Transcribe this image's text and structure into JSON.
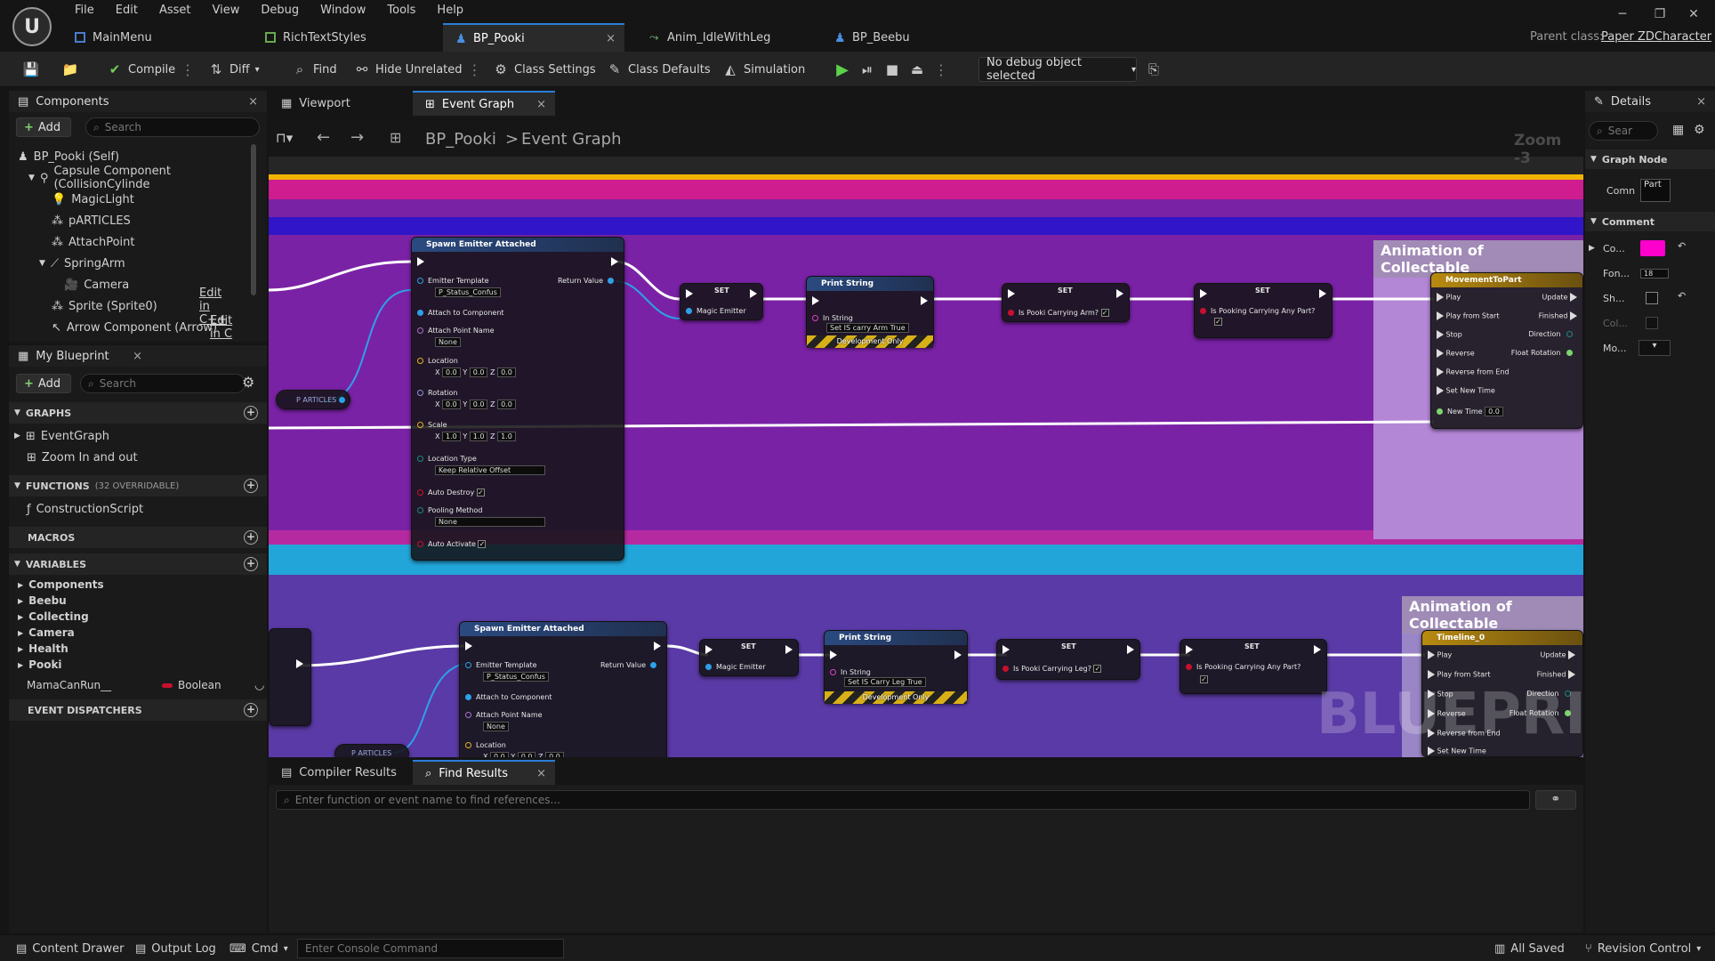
{
  "app": {
    "menu": [
      "File",
      "Edit",
      "Asset",
      "View",
      "Debug",
      "Window",
      "Tools",
      "Help"
    ],
    "tabs": [
      {
        "label": "MainMenu"
      },
      {
        "label": "RichTextStyles"
      },
      {
        "label": "BP_Pooki",
        "close": "×"
      },
      {
        "label": "Anim_IdleWithLeg"
      },
      {
        "label": "BP_Beebu"
      }
    ],
    "parent_class_label": "Parent class:",
    "parent_class_value": "Paper ZDCharacter"
  },
  "toolbar": {
    "compile": "Compile",
    "diff": "Diff",
    "find": "Find",
    "hide_unrelated": "Hide Unrelated",
    "class_settings": "Class Settings",
    "class_defaults": "Class Defaults",
    "simulation": "Simulation",
    "debug_object": "No debug object selected"
  },
  "components_panel": {
    "title": "Components",
    "add": "Add",
    "search_placeholder": "Search",
    "items": [
      {
        "label": "BP_Pooki (Self)"
      },
      {
        "label": "Capsule Component (CollisionCylinde"
      },
      {
        "label": "MagicLight"
      },
      {
        "label": "pARTICLES"
      },
      {
        "label": "AttachPoint"
      },
      {
        "label": "SpringArm"
      },
      {
        "label": "Camera"
      },
      {
        "label": "Sprite (Sprite0)",
        "link": "Edit in C++"
      },
      {
        "label": "Arrow Component (Arrow)",
        "link": "Edit in C"
      }
    ]
  },
  "my_blueprint": {
    "title": "My Blueprint",
    "add": "Add",
    "search_placeholder": "Search",
    "graphs_header": "GRAPHS",
    "graphs": [
      "EventGraph",
      "Zoom In and out"
    ],
    "functions_header": "FUNCTIONS",
    "functions_count": "(32 OVERRIDABLE)",
    "functions": [
      "ConstructionScript"
    ],
    "macros_header": "MACROS",
    "variables_header": "VARIABLES",
    "variable_groups": [
      "Components",
      "Beebu",
      "Collecting",
      "Camera",
      "Health",
      "Pooki"
    ],
    "variable_name": "MamaCanRun__",
    "variable_type": "Boolean",
    "dispatchers_header": "EVENT DISPATCHERS"
  },
  "editor": {
    "tabs": [
      {
        "label": "Viewport"
      },
      {
        "label": "Event Graph",
        "close": "×"
      }
    ],
    "breadcrumb_root": "BP_Pooki",
    "breadcrumb_sep": ">",
    "breadcrumb_current": "Event Graph",
    "zoom": "Zoom -3",
    "watermark": "BLUEPRINT"
  },
  "graph": {
    "comment_title_1": "Animation of Collectable",
    "comment_title_2": "Animation of Collectable",
    "spawn_title": "Spawn Emitter Attached",
    "emitter_template": "Emitter Template",
    "emitter_value": "P_Status_Confus",
    "return_value": "Return Value",
    "attach_to_component": "Attach to Component",
    "attach_point_name": "Attach Point Name",
    "none": "None",
    "location": "Location",
    "rotation": "Rotation",
    "scale": "Scale",
    "location_type": "Location Type",
    "location_type_value": "Keep Relative Offset",
    "auto_destroy": "Auto Destroy",
    "pooling_method": "Pooling Method",
    "auto_activate": "Auto Activate",
    "particles": "P ARTICLES",
    "set": "SET",
    "magic_emitter": "Magic Emitter",
    "print_string": "Print String",
    "in_string": "In String",
    "in_string_value_1": "Set IS carry Arm True",
    "in_string_value_2": "Set IS Carry Leg True",
    "dev_only": "Development Only",
    "carrying_arm": "Is Pooki Carrying Arm?",
    "carrying_leg": "Is Pooki Carrying Leg?",
    "carrying_any": "Is Pooking Carrying Any Part?",
    "timeline_1": "MovementToPart",
    "timeline_2": "Timeline_0",
    "tl_play": "Play",
    "tl_play_from_start": "Play from Start",
    "tl_stop": "Stop",
    "tl_reverse": "Reverse",
    "tl_reverse_from_end": "Reverse from End",
    "tl_set_new_time": "Set New Time",
    "tl_new_time": "New Time",
    "tl_new_time_value": "0.0",
    "tl_update": "Update",
    "tl_finished": "Finished",
    "tl_direction": "Direction",
    "tl_float_rotation": "Float Rotation",
    "zero": "0.0",
    "one": "1.0",
    "x": "X",
    "y": "Y",
    "z": "Z"
  },
  "bottom_panel": {
    "tabs": [
      {
        "label": "Compiler Results"
      },
      {
        "label": "Find Results",
        "close": "×"
      }
    ],
    "find_placeholder": "Enter function or event name to find references..."
  },
  "details": {
    "title": "Details",
    "search_placeholder": "Sear",
    "graph_node_header": "Graph Node",
    "comment_label": "Comn",
    "comment_value": "Part",
    "comment_header": "Comment",
    "rows": [
      "Co...",
      "Fon...",
      "Sh...",
      "Col...",
      "Mo..."
    ],
    "font_size": "18",
    "comment_color": "#ff00cc"
  },
  "statusbar": {
    "content_drawer": "Content Drawer",
    "output_log": "Output Log",
    "cmd": "Cmd",
    "console_placeholder": "Enter Console Command",
    "all_saved": "All Saved",
    "revision_control": "Revision Control"
  }
}
